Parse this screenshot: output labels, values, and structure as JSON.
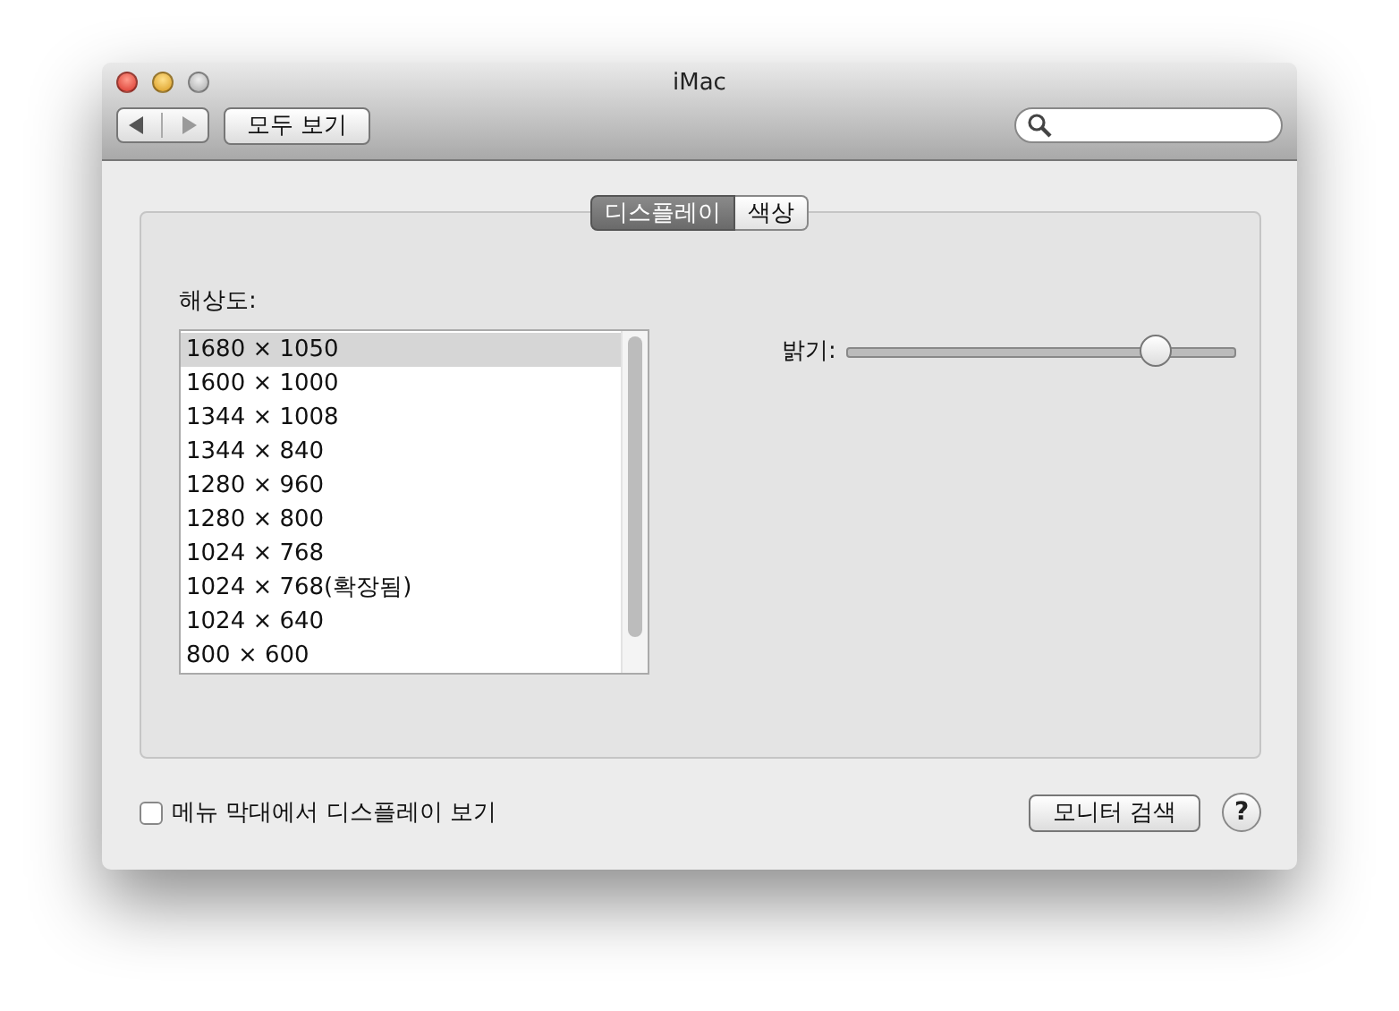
{
  "window": {
    "title": "iMac"
  },
  "toolbar": {
    "show_all_button": "모두 보기"
  },
  "tabs": [
    {
      "label": "디스플레이",
      "selected": true
    },
    {
      "label": "색상",
      "selected": false
    }
  ],
  "resolution": {
    "label": "해상도:",
    "options": [
      {
        "label": "1680 × 1050",
        "selected": true
      },
      {
        "label": "1600 × 1000",
        "selected": false
      },
      {
        "label": "1344 × 1008",
        "selected": false
      },
      {
        "label": "1344 × 840",
        "selected": false
      },
      {
        "label": "1280 × 960",
        "selected": false
      },
      {
        "label": "1280 × 800",
        "selected": false
      },
      {
        "label": "1024 × 768",
        "selected": false
      },
      {
        "label": "1024 × 768(확장됨)",
        "selected": false
      },
      {
        "label": "1024 × 640",
        "selected": false
      },
      {
        "label": "800 × 600",
        "selected": false
      }
    ]
  },
  "brightness": {
    "label": "밝기:",
    "level": 0.79
  },
  "menu_bar_checkbox": {
    "label": "메뉴 막대에서 디스플레이 보기",
    "checked": false
  },
  "detect_button": "모니터 검색",
  "help_button": "?"
}
